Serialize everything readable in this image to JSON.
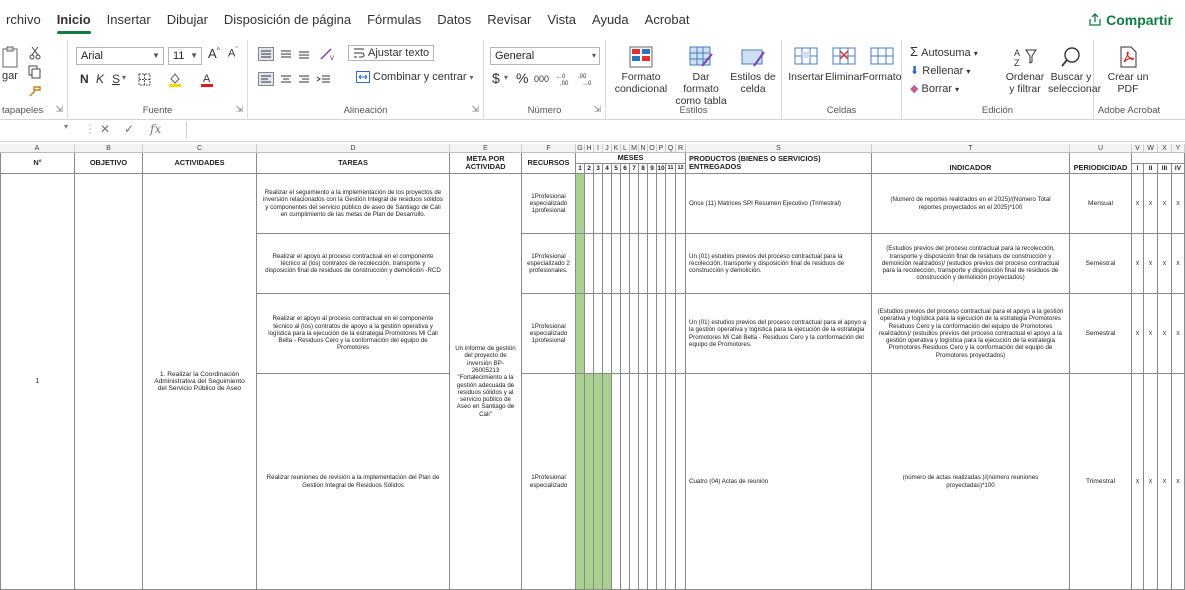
{
  "menubar": {
    "tabs": [
      "rchivo",
      "Inicio",
      "Insertar",
      "Dibujar",
      "Disposición de página",
      "Fórmulas",
      "Datos",
      "Revisar",
      "Vista",
      "Ayuda",
      "Acrobat"
    ],
    "share": "Compartir"
  },
  "ribbon": {
    "clipboard": {
      "paste": "gar",
      "label": "tapapeles"
    },
    "font": {
      "name": "Arial",
      "size": "11",
      "label": "Fuente",
      "bold": "N",
      "italic": "K",
      "underline": "S"
    },
    "alignment": {
      "wrap": "Ajustar texto",
      "merge": "Combinar y centrar",
      "label": "Alineación"
    },
    "number": {
      "format": "General",
      "currency": "$",
      "percent": "%",
      "thousands": "000",
      "label": "Número"
    },
    "styles": {
      "conditional": "Formato condicional",
      "table": "Dar formato como tabla",
      "cell": "Estilos de celda",
      "label": "Estilos"
    },
    "cells": {
      "insert": "Insertar",
      "delete": "Eliminar",
      "format": "Formato",
      "label": "Celdas"
    },
    "editing": {
      "autosum": "Autosuma",
      "fill": "Rellenar",
      "clear": "Borrar",
      "sort": "Ordenar y filtrar",
      "find": "Buscar y seleccionar",
      "label": "Edición"
    },
    "acrobat": {
      "create": "Crear un PDF",
      "label": "Adobe Acrobat"
    }
  },
  "formula_bar": {
    "fx": "fx"
  },
  "columns": {
    "A": "A",
    "B": "B",
    "C": "C",
    "D": "D",
    "E": "E",
    "F": "F",
    "GR": [
      "G",
      "H",
      "I",
      "J",
      "K",
      "L",
      "M",
      "N",
      "O",
      "P",
      "Q",
      "R"
    ],
    "S": "S",
    "T": "T",
    "U": "U",
    "VY": [
      "V",
      "W",
      "X",
      "Y"
    ]
  },
  "headers": {
    "num": "N°",
    "objetivo": "OBJETIVO",
    "actividades": "ACTIVIDADES",
    "tareas": "TAREAS",
    "meta": "META POR ACTIVIDAD",
    "recursos": "RECURSOS",
    "meses": "MESES",
    "months": [
      "1",
      "2",
      "3",
      "4",
      "5",
      "6",
      "7",
      "8",
      "9",
      "10",
      "11",
      "12"
    ],
    "productos": "PRODUCTOS (BIENES O SERVICIOS) ENTREGADOS",
    "indicador": "INDICADOR",
    "periodicidad": "PERIODICIDAD",
    "trimestres": [
      "I",
      "II",
      "III",
      "IV"
    ]
  },
  "body": {
    "num": "1",
    "actividad": "1. Realizar la Coordinación Administrativa del Seguimiento del Servicio Público de Aseo",
    "meta": "Un informe de gestión del proyecto de inversión BP-26005213 \"Fortalecimiento a la gestión adecuada de residuos sólidos y al servicio público de Aseo en Santiago de Cali\"",
    "mark": "x",
    "rows": [
      {
        "tarea": "Realizar el seguimiento a la implementación de los proyectos de inversión relacionados con la Gestión Integral de residuos sólidos y componentes del servicio público de aseo de Santiago de Cali en cumplimiento de las metas de Plan de Desarrollo.",
        "recursos": "1Profesional especializado 1profesional",
        "producto": "Once (11) Matrices SPI Resumen Ejecutivo (Trimestral)",
        "indicador": "(Número de reportes realizados en el 2025)/(Número Total reportes proyectados en el 2025)*100",
        "periodicidad": "Mensual"
      },
      {
        "tarea": "Realizar el apoyo al proceso contractual en el componente técnico al (los) contratos de recolección, transporte y disposición final de residuos de construcción y demolición -RCD",
        "recursos": "1Profesional especializado 2 profesionales.",
        "producto": "Un (01) estudios previos del proceso contractual para la recolección, transporte y disposición final de residuos de construcción y demolición.",
        "indicador": "(Estudios previos del proceso contractual para la recolección, transporte y disposición final de residuos de construcción y demolición realizados)/ (estudios previos del proceso contractual para la recolección, transporte y disposición final de residuos de construcción y demolición proyectados)",
        "periodicidad": "Semestral"
      },
      {
        "tarea": "Realizar el apoyo al proceso contractual en el componente técnico al (los) contratos de apoyo a la gestión operativa y logística para la ejecución de la estrategia Promotores Mi Cali Bella - Residuos Cero y la conformación del equipo de Promotores",
        "recursos": "1Profesional especializado 1profesional",
        "producto": "Un (01) estudios previos del proceso contractual para el apoyo a la gestión operativa y logística para la ejecución de la estrategia Promotores Mi Cali Bella - Residuos Cero y la conformación del equipo de Promotores.",
        "indicador": "(Estudios previos del proceso contractual para el apoyo a la gestión operativa y logística para la ejecución de la estrategia Promotores Residuos Cero y la conformación del equipo de Promotores realizados)/ (estudios previos del proceso contractual el apoyo a la gestión operativa y logística para la ejecución de la estrategia Promotores Residuos Cero y la conformación del equipo de Promotores proyectados)",
        "periodicidad": "Semestral"
      },
      {
        "tarea": "Realizar reuniones de revisión a la implementación del Plan de Gestión Integral de Residuos Sólidos",
        "recursos": "1Profesional especializado",
        "producto": "Cuatro (04) Actas de reunión",
        "indicador": "(número de actas realizadas )/(número reuniones proyectadas)*100",
        "periodicidad": "Trimestral"
      }
    ]
  },
  "colors": {
    "accent": "#107c41",
    "green_fill": "#a9d08e"
  }
}
